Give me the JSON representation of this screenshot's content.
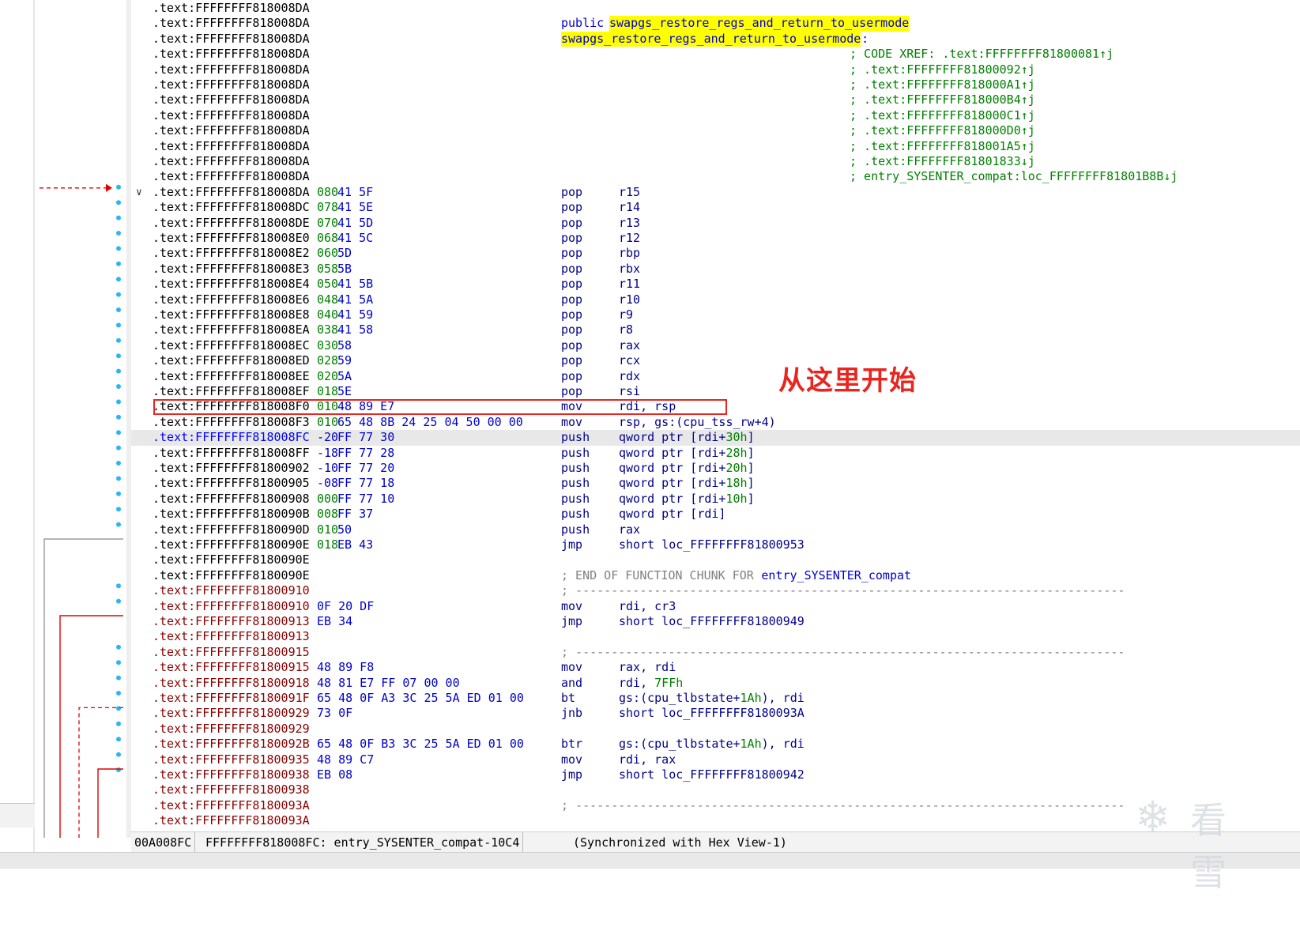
{
  "annotation": "从这里开始",
  "watermark": "看雪",
  "status": {
    "offset": "00A008FC",
    "location": "FFFFFFFF818008FC: entry_SYSENTER_compat-10C4",
    "sync": "(Synchronized with Hex View-1)"
  },
  "rows": [
    {
      "addr": ".text:FFFFFFFF818008DA",
      "addr_color": "black"
    },
    {
      "addr": ".text:FFFFFFFF818008DA",
      "addr_color": "black",
      "kw": "public",
      "sym": "swapgs_restore_regs_and_return_to_usermode"
    },
    {
      "addr": ".text:FFFFFFFF818008DA",
      "addr_color": "black",
      "label": "swapgs_restore_regs_and_return_to_usermode",
      "label_suffix": ":"
    },
    {
      "addr": ".text:FFFFFFFF818008DA",
      "addr_color": "black",
      "xref": "; CODE XREF: .text:FFFFFFFF81800081↑j"
    },
    {
      "addr": ".text:FFFFFFFF818008DA",
      "addr_color": "black",
      "xref": "; .text:FFFFFFFF81800092↑j"
    },
    {
      "addr": ".text:FFFFFFFF818008DA",
      "addr_color": "black",
      "xref": "; .text:FFFFFFFF818000A1↑j"
    },
    {
      "addr": ".text:FFFFFFFF818008DA",
      "addr_color": "black",
      "xref": "; .text:FFFFFFFF818000B4↑j"
    },
    {
      "addr": ".text:FFFFFFFF818008DA",
      "addr_color": "black",
      "xref": "; .text:FFFFFFFF818000C1↑j"
    },
    {
      "addr": ".text:FFFFFFFF818008DA",
      "addr_color": "black",
      "xref": "; .text:FFFFFFFF818000D0↑j"
    },
    {
      "addr": ".text:FFFFFFFF818008DA",
      "addr_color": "black",
      "xref": "; .text:FFFFFFFF818001A5↑j"
    },
    {
      "addr": ".text:FFFFFFFF818008DA",
      "addr_color": "black",
      "xref": "; .text:FFFFFFFF81801833↓j"
    },
    {
      "addr": ".text:FFFFFFFF818008DA",
      "addr_color": "black",
      "xref": "; entry_SYSENTER_compat:loc_FFFFFFFF81801B8B↓j"
    },
    {
      "addr": ".text:FFFFFFFF818008DA",
      "addr_color": "black",
      "sp": "080",
      "bytes": "41 5F",
      "mnem": "pop",
      "ops": "r15",
      "fold": "∨"
    },
    {
      "addr": ".text:FFFFFFFF818008DC",
      "addr_color": "black",
      "sp": "078",
      "bytes": "41 5E",
      "mnem": "pop",
      "ops": "r14"
    },
    {
      "addr": ".text:FFFFFFFF818008DE",
      "addr_color": "black",
      "sp": "070",
      "bytes": "41 5D",
      "mnem": "pop",
      "ops": "r13"
    },
    {
      "addr": ".text:FFFFFFFF818008E0",
      "addr_color": "black",
      "sp": "068",
      "bytes": "41 5C",
      "mnem": "pop",
      "ops": "r12"
    },
    {
      "addr": ".text:FFFFFFFF818008E2",
      "addr_color": "black",
      "sp": "060",
      "bytes": "5D",
      "mnem": "pop",
      "ops": "rbp"
    },
    {
      "addr": ".text:FFFFFFFF818008E3",
      "addr_color": "black",
      "sp": "058",
      "bytes": "5B",
      "mnem": "pop",
      "ops": "rbx"
    },
    {
      "addr": ".text:FFFFFFFF818008E4",
      "addr_color": "black",
      "sp": "050",
      "bytes": "41 5B",
      "mnem": "pop",
      "ops": "r11"
    },
    {
      "addr": ".text:FFFFFFFF818008E6",
      "addr_color": "black",
      "sp": "048",
      "bytes": "41 5A",
      "mnem": "pop",
      "ops": "r10"
    },
    {
      "addr": ".text:FFFFFFFF818008E8",
      "addr_color": "black",
      "sp": "040",
      "bytes": "41 59",
      "mnem": "pop",
      "ops": "r9"
    },
    {
      "addr": ".text:FFFFFFFF818008EA",
      "addr_color": "black",
      "sp": "038",
      "bytes": "41 58",
      "mnem": "pop",
      "ops": "r8"
    },
    {
      "addr": ".text:FFFFFFFF818008EC",
      "addr_color": "black",
      "sp": "030",
      "bytes": "58",
      "mnem": "pop",
      "ops": "rax"
    },
    {
      "addr": ".text:FFFFFFFF818008ED",
      "addr_color": "black",
      "sp": "028",
      "bytes": "59",
      "mnem": "pop",
      "ops": "rcx"
    },
    {
      "addr": ".text:FFFFFFFF818008EE",
      "addr_color": "black",
      "sp": "020",
      "bytes": "5A",
      "mnem": "pop",
      "ops": "rdx"
    },
    {
      "addr": ".text:FFFFFFFF818008EF",
      "addr_color": "black",
      "sp": "018",
      "bytes": "5E",
      "mnem": "pop",
      "ops": "rsi"
    },
    {
      "addr": ".text:FFFFFFFF818008F0",
      "addr_color": "black",
      "sp": "010",
      "bytes": "48 89 E7",
      "mnem": "mov",
      "ops": "rdi, rsp"
    },
    {
      "addr": ".text:FFFFFFFF818008F3",
      "addr_color": "black",
      "sp": "010",
      "bytes": "65 48 8B 24 25 04 50 00 00",
      "mnem": "mov",
      "ops": "rsp, gs:(cpu_tss_rw+4)"
    },
    {
      "addr": ".text:FFFFFFFF818008FC",
      "addr_color": "blue",
      "sp": "-20",
      "sp_neg": true,
      "bytes": "FF 77 30",
      "mnem": "push",
      "ops": "qword ptr [rdi+",
      "ops_num": "30h",
      "ops_tail": "]",
      "highlight": true
    },
    {
      "addr": ".text:FFFFFFFF818008FF",
      "addr_color": "black",
      "sp": "-18",
      "sp_neg": true,
      "bytes": "FF 77 28",
      "mnem": "push",
      "ops": "qword ptr [rdi+",
      "ops_num": "28h",
      "ops_tail": "]"
    },
    {
      "addr": ".text:FFFFFFFF81800902",
      "addr_color": "black",
      "sp": "-10",
      "sp_neg": true,
      "bytes": "FF 77 20",
      "mnem": "push",
      "ops": "qword ptr [rdi+",
      "ops_num": "20h",
      "ops_tail": "]"
    },
    {
      "addr": ".text:FFFFFFFF81800905",
      "addr_color": "black",
      "sp": "-08",
      "sp_neg": true,
      "bytes": "FF 77 18",
      "mnem": "push",
      "ops": "qword ptr [rdi+",
      "ops_num": "18h",
      "ops_tail": "]"
    },
    {
      "addr": ".text:FFFFFFFF81800908",
      "addr_color": "black",
      "sp": "000",
      "bytes": "FF 77 10",
      "mnem": "push",
      "ops": "qword ptr [rdi+",
      "ops_num": "10h",
      "ops_tail": "]"
    },
    {
      "addr": ".text:FFFFFFFF8180090B",
      "addr_color": "black",
      "sp": "008",
      "bytes": "FF 37",
      "mnem": "push",
      "ops": "qword ptr [rdi]"
    },
    {
      "addr": ".text:FFFFFFFF8180090D",
      "addr_color": "black",
      "sp": "010",
      "bytes": "50",
      "mnem": "push",
      "ops": "rax"
    },
    {
      "addr": ".text:FFFFFFFF8180090E",
      "addr_color": "black",
      "sp": "018",
      "bytes": "EB 43",
      "mnem": "jmp",
      "ops": "short loc_FFFFFFFF81800953"
    },
    {
      "addr": ".text:FFFFFFFF8180090E",
      "addr_color": "black"
    },
    {
      "addr": ".text:FFFFFFFF8180090E",
      "addr_color": "black",
      "gray": "; END OF FUNCTION CHUNK FOR ",
      "gray_sym": "entry_SYSENTER_compat"
    },
    {
      "addr": ".text:FFFFFFFF81800910",
      "addr_color": "red",
      "sep": "; -----------------------------------------------------------------------------"
    },
    {
      "addr": ".text:FFFFFFFF81800910",
      "addr_color": "red",
      "bytes": "0F 20 DF",
      "bytes_left": true,
      "mnem": "mov",
      "ops": "rdi, cr3"
    },
    {
      "addr": ".text:FFFFFFFF81800913",
      "addr_color": "red",
      "bytes": "EB 34",
      "bytes_left": true,
      "mnem": "jmp",
      "ops": "short loc_FFFFFFFF81800949"
    },
    {
      "addr": ".text:FFFFFFFF81800913",
      "addr_color": "red"
    },
    {
      "addr": ".text:FFFFFFFF81800915",
      "addr_color": "red",
      "sep": "; -----------------------------------------------------------------------------"
    },
    {
      "addr": ".text:FFFFFFFF81800915",
      "addr_color": "red",
      "bytes": "48 89 F8",
      "bytes_left": true,
      "mnem": "mov",
      "ops": "rax, rdi"
    },
    {
      "addr": ".text:FFFFFFFF81800918",
      "addr_color": "red",
      "bytes": "48 81 E7 FF 07 00 00",
      "bytes_left": true,
      "mnem": "and",
      "ops": "rdi, ",
      "ops_num": "7FFh",
      "ops_tail": ""
    },
    {
      "addr": ".text:FFFFFFFF8180091F",
      "addr_color": "red",
      "bytes": "65 48 0F A3 3C 25 5A ED 01 00",
      "bytes_left": true,
      "mnem": "bt",
      "ops": "gs:(cpu_tlbstate+",
      "ops_num": "1Ah",
      "ops_tail": "), rdi"
    },
    {
      "addr": ".text:FFFFFFFF81800929",
      "addr_color": "red",
      "bytes": "73 0F",
      "bytes_left": true,
      "mnem": "jnb",
      "ops": "short loc_FFFFFFFF8180093A"
    },
    {
      "addr": ".text:FFFFFFFF81800929",
      "addr_color": "red"
    },
    {
      "addr": ".text:FFFFFFFF8180092B",
      "addr_color": "red",
      "bytes": "65 48 0F B3 3C 25 5A ED 01 00",
      "bytes_left": true,
      "mnem": "btr",
      "ops": "gs:(cpu_tlbstate+",
      "ops_num": "1Ah",
      "ops_tail": "), rdi"
    },
    {
      "addr": ".text:FFFFFFFF81800935",
      "addr_color": "red",
      "bytes": "48 89 C7",
      "bytes_left": true,
      "mnem": "mov",
      "ops": "rdi, rax"
    },
    {
      "addr": ".text:FFFFFFFF81800938",
      "addr_color": "red",
      "bytes": "EB 08",
      "bytes_left": true,
      "mnem": "jmp",
      "ops": "short loc_FFFFFFFF81800942"
    },
    {
      "addr": ".text:FFFFFFFF81800938",
      "addr_color": "red"
    },
    {
      "addr": ".text:FFFFFFFF8180093A",
      "addr_color": "red",
      "sep": "; -----------------------------------------------------------------------------"
    },
    {
      "addr": ".text:FFFFFFFF8180093A",
      "addr_color": "red"
    }
  ]
}
